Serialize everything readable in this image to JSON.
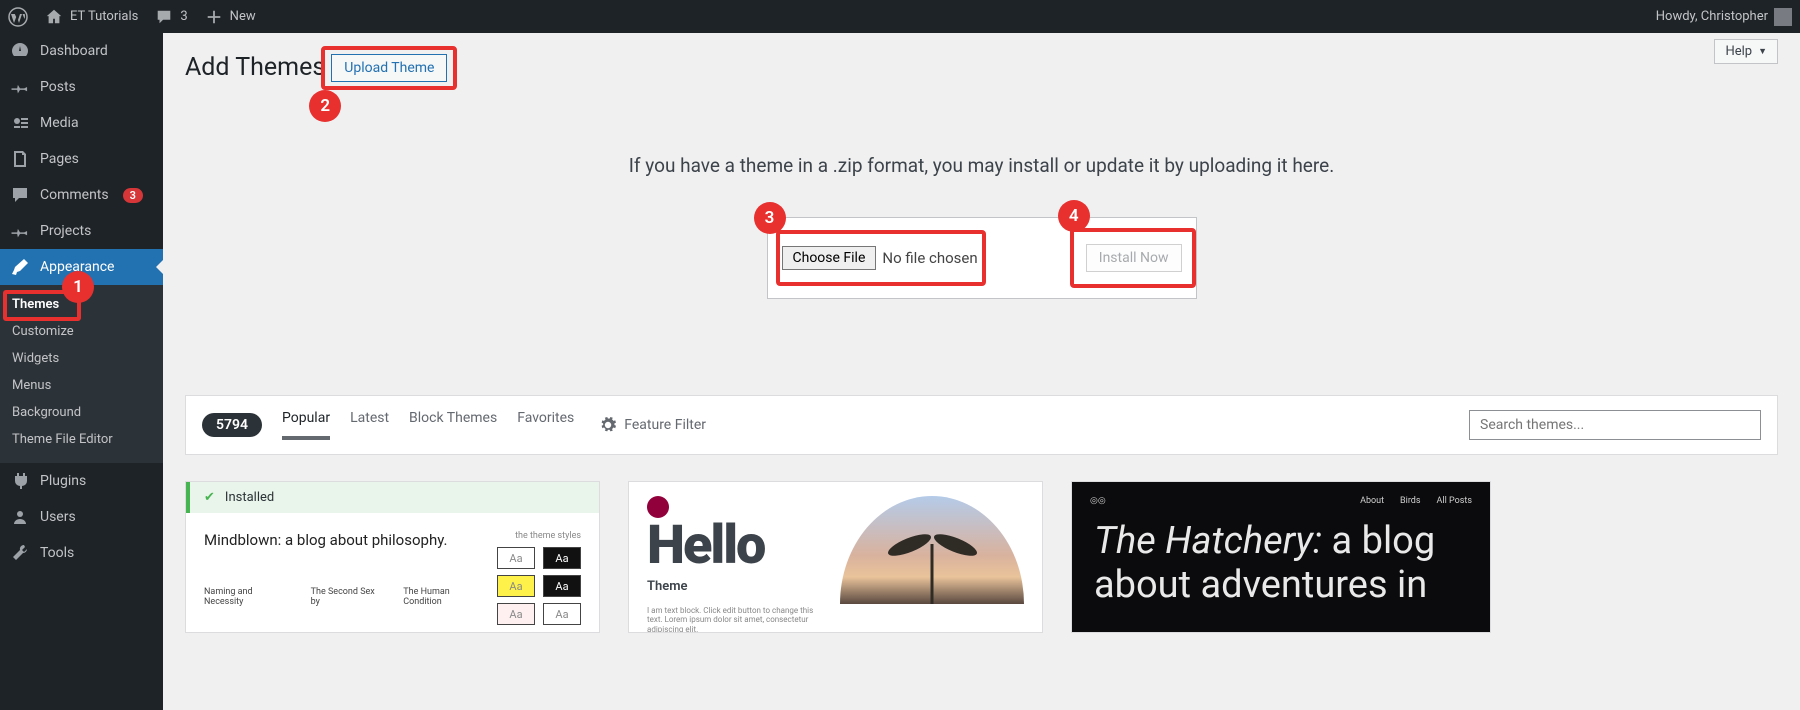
{
  "adminbar": {
    "site_name": "ET Tutorials",
    "comments_count": "3",
    "new_label": "New",
    "howdy": "Howdy, Christopher"
  },
  "sidebar": {
    "items": [
      {
        "label": "Dashboard"
      },
      {
        "label": "Posts"
      },
      {
        "label": "Media"
      },
      {
        "label": "Pages"
      },
      {
        "label": "Comments",
        "badge": "3"
      },
      {
        "label": "Projects"
      },
      {
        "label": "Appearance"
      },
      {
        "label": "Plugins"
      },
      {
        "label": "Users"
      },
      {
        "label": "Tools"
      }
    ],
    "submenu": {
      "themes": "Themes",
      "customize": "Customize",
      "widgets": "Widgets",
      "menus": "Menus",
      "background": "Background",
      "editor": "Theme File Editor"
    }
  },
  "header": {
    "title": "Add Themes",
    "upload_btn": "Upload Theme",
    "help": "Help"
  },
  "annotations": {
    "a1": "1",
    "a2": "2",
    "a3": "3",
    "a4": "4"
  },
  "upload": {
    "info": "If you have a theme in a .zip format, you may install or update it by uploading it here.",
    "choose": "Choose File",
    "no_file": "No file chosen",
    "install": "Install Now"
  },
  "browse": {
    "count": "5794",
    "popular": "Popular",
    "latest": "Latest",
    "block": "Block Themes",
    "favorites": "Favorites",
    "filter": "Feature Filter",
    "search_placeholder": "Search themes..."
  },
  "grid": {
    "installed": "Installed",
    "t1_title": "Mindblown: a blog about philosophy.",
    "t1_sw_label": "the theme styles",
    "t1_sw_text": "Aa",
    "t1_books": [
      "Naming and Necessity",
      "The Second Sex by",
      "The Human Condition"
    ],
    "t2_hello": "Hello",
    "t2_sub": "Theme",
    "t2_lorem": "I am text block. Click edit button to change this text. Lorem ipsum dolor sit amet, consectetur adipiscing elit.",
    "t3_nav": {
      "about": "About",
      "birds": "Birds",
      "all": "All Posts"
    },
    "t3_title_em": "The Hatchery:",
    "t3_title_rest": " a blog about adventures in"
  }
}
